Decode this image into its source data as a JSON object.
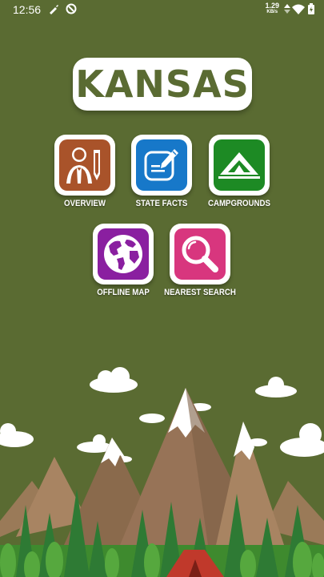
{
  "status_bar": {
    "time": "12:56",
    "net_speed": "1.29",
    "net_unit": "KB/s"
  },
  "title": "KANSAS",
  "menu": {
    "overview": "OVERVIEW",
    "state_facts": "STATE FACTS",
    "campgrounds": "CAMPGROUNDS",
    "offline_map": "OFFLINE MAP",
    "nearest_search": "NEAREST SEARCH"
  },
  "colors": {
    "background": "#5a6b32",
    "overview": "#a9532a",
    "state_facts": "#1778c9",
    "campgrounds": "#1d8a24",
    "offline_map": "#8a1fa0",
    "nearest_search": "#d8367e"
  }
}
